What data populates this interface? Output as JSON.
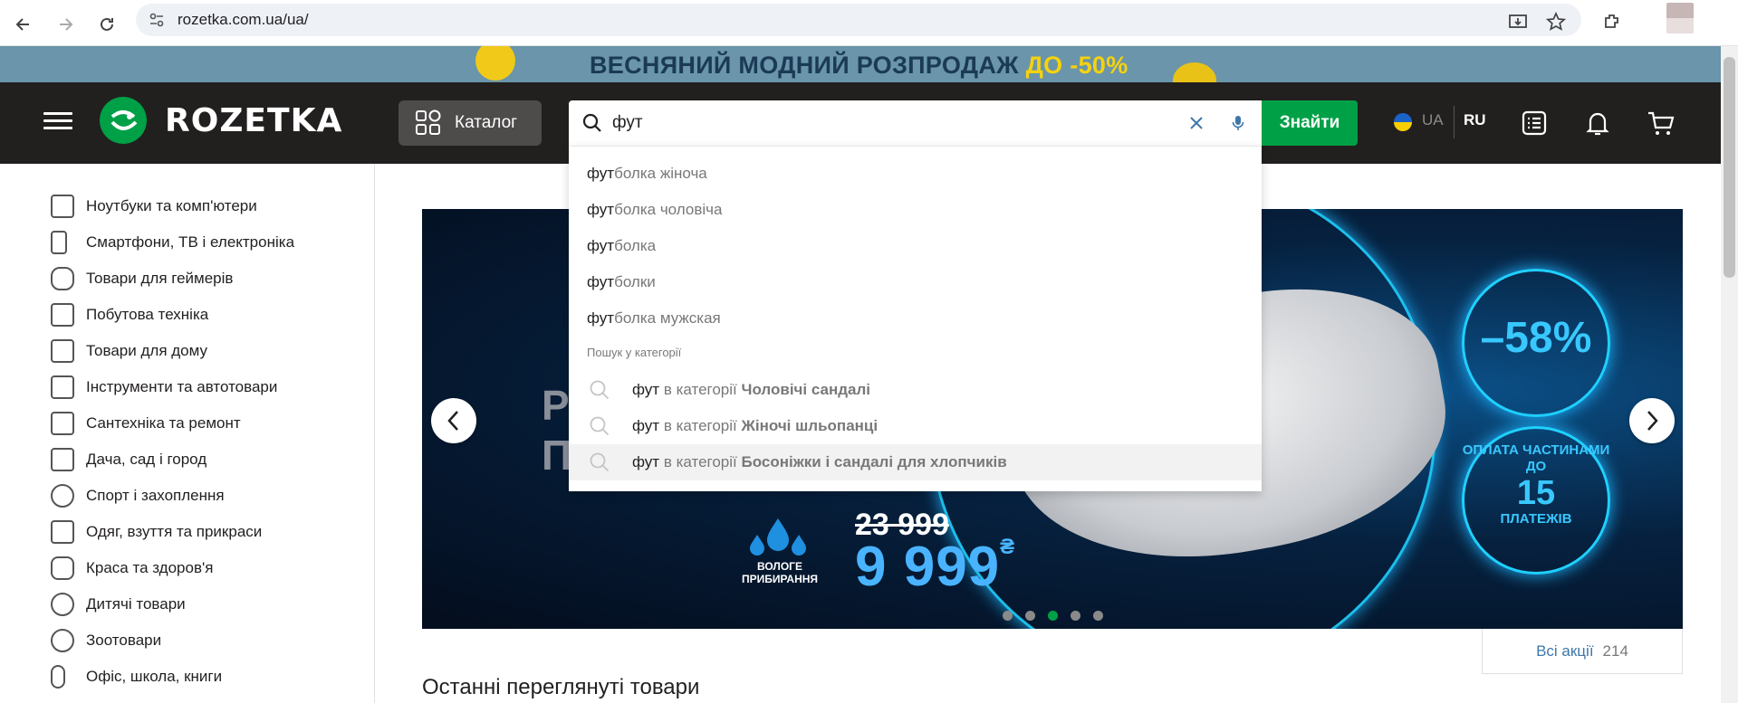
{
  "browser": {
    "url": "rozetka.com.ua/ua/"
  },
  "promo_banner": {
    "text": "ВЕСНЯНИЙ МОДНИЙ РОЗПРОДАЖ",
    "highlight": "ДО -50%"
  },
  "header": {
    "logo_text": "ROZETKA",
    "catalog_label": "Каталог",
    "search_value": "фут",
    "search_button": "Знайти",
    "lang_ua": "UA",
    "lang_ru": "RU"
  },
  "sidebar": {
    "items": [
      {
        "label": "Ноутбуки та комп'ютери",
        "icon": "laptop-icon"
      },
      {
        "label": "Смартфони, ТВ і електроніка",
        "icon": "smartphone-icon"
      },
      {
        "label": "Товари для геймерів",
        "icon": "gamepad-icon"
      },
      {
        "label": "Побутова техніка",
        "icon": "washing-machine-icon"
      },
      {
        "label": "Товари для дому",
        "icon": "sofa-icon"
      },
      {
        "label": "Інструменти та автотовари",
        "icon": "drill-icon"
      },
      {
        "label": "Сантехніка та ремонт",
        "icon": "bathtub-icon"
      },
      {
        "label": "Дача, сад і город",
        "icon": "garden-tools-icon"
      },
      {
        "label": "Спорт і захоплення",
        "icon": "racket-icon"
      },
      {
        "label": "Одяг, взуття та прикраси",
        "icon": "tshirt-icon"
      },
      {
        "label": "Краса та здоров'я",
        "icon": "cosmetics-icon"
      },
      {
        "label": "Дитячі товари",
        "icon": "teddy-bear-icon"
      },
      {
        "label": "Зоотовари",
        "icon": "paw-icon"
      },
      {
        "label": "Офіс, школа, книги",
        "icon": "paperclip-icon"
      }
    ]
  },
  "search_dropdown": {
    "query": "фут",
    "suggestions": [
      {
        "rest": "болка жіноча"
      },
      {
        "rest": "болка чоловіча"
      },
      {
        "rest": "болка"
      },
      {
        "rest": "болки"
      },
      {
        "rest": "болка мужская"
      }
    ],
    "category_heading": "Пошук у категорії",
    "in_category": "в категорії",
    "categories": [
      {
        "name": "Чоловічі сандалі"
      },
      {
        "name": "Жіночі шльопанці"
      },
      {
        "name": "Босоніжки і сандалі для хлопчиків"
      }
    ]
  },
  "hero": {
    "ghost_text_1": "Р",
    "ghost_text_2": "П",
    "old_price": "23 999",
    "new_price": "9 999",
    "currency": "₴",
    "wet_label": "ВОЛОГЕ ПРИБИРАННЯ",
    "discount": "–58%",
    "pay_line1": "ОПЛАТА ЧАСТИНАМИ ДО",
    "pay_num": "15",
    "pay_line2": "ПЛАТЕЖІВ",
    "active_slide": 3,
    "slide_count": 5
  },
  "all_promos": {
    "label": "Всі акції",
    "count": "214"
  },
  "section": {
    "recent_title": "Останні переглянуті товари"
  },
  "colors": {
    "brand_green": "#00a046",
    "header_dark": "#221f1f",
    "link_blue": "#3e77aa"
  }
}
